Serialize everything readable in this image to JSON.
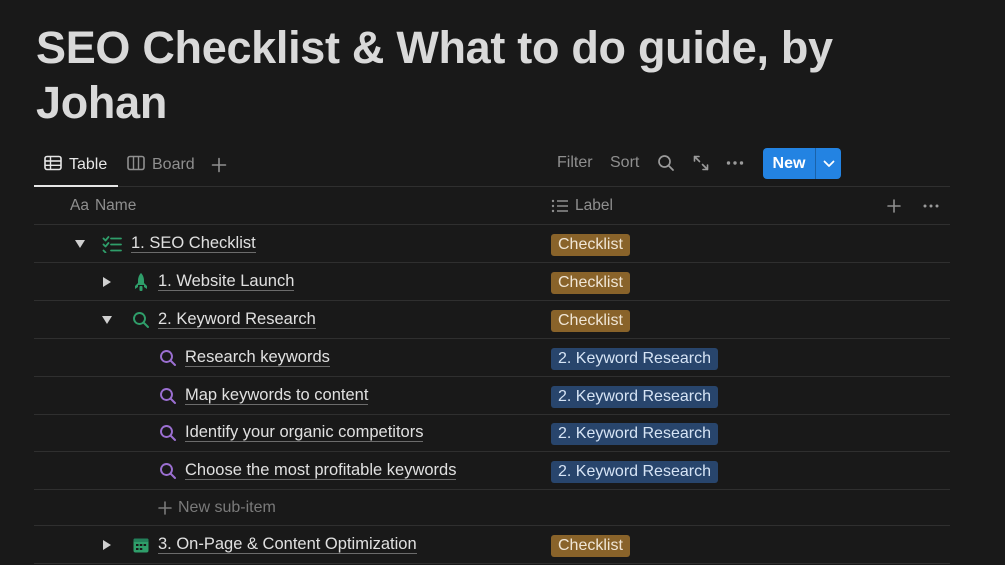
{
  "page": {
    "title": "SEO Checklist & What to do guide, by Johan"
  },
  "views": {
    "tabs": [
      {
        "label": "Table",
        "icon": "table-icon"
      },
      {
        "label": "Board",
        "icon": "board-icon"
      }
    ],
    "add_view_icon": "plus-icon",
    "filter_label": "Filter",
    "sort_label": "Sort",
    "new_label": "New"
  },
  "table": {
    "columns": {
      "name_prefix": "Aa",
      "name": "Name",
      "label": "Label"
    },
    "rows": [
      {
        "name": "1. SEO Checklist",
        "label": "Checklist",
        "label_type": "checklist",
        "toggle": "expanded",
        "icon": "checklist-icon"
      },
      {
        "name": "1. Website Launch",
        "label": "Checklist",
        "label_type": "checklist",
        "toggle": "collapsed",
        "icon": "rocket-icon"
      },
      {
        "name": "2. Keyword Research",
        "label": "Checklist",
        "label_type": "checklist",
        "toggle": "expanded",
        "icon": "search-icon"
      },
      {
        "name": "Research keywords",
        "label": "2. Keyword Research",
        "label_type": "keyword",
        "icon": "search-icon"
      },
      {
        "name": "Map keywords to content",
        "label": "2. Keyword Research",
        "label_type": "keyword",
        "icon": "search-icon"
      },
      {
        "name": "Identify your organic competitors",
        "label": "2. Keyword Research",
        "label_type": "keyword",
        "icon": "search-icon"
      },
      {
        "name": "Choose the most profitable keywords",
        "label": "2. Keyword Research",
        "label_type": "keyword",
        "icon": "search-icon"
      },
      {
        "name": "3. On-Page & Content Optimization",
        "label": "Checklist",
        "label_type": "checklist",
        "toggle": "collapsed",
        "icon": "calendar-icon"
      }
    ],
    "new_sub_item": "New sub-item"
  },
  "colors": {
    "background": "#191919",
    "accent": "#2383e2",
    "tag_checklist": "#89632a",
    "tag_keyword": "#28456c",
    "icon_green": "#2f9e6a",
    "icon_purple": "#9b6fd1"
  }
}
